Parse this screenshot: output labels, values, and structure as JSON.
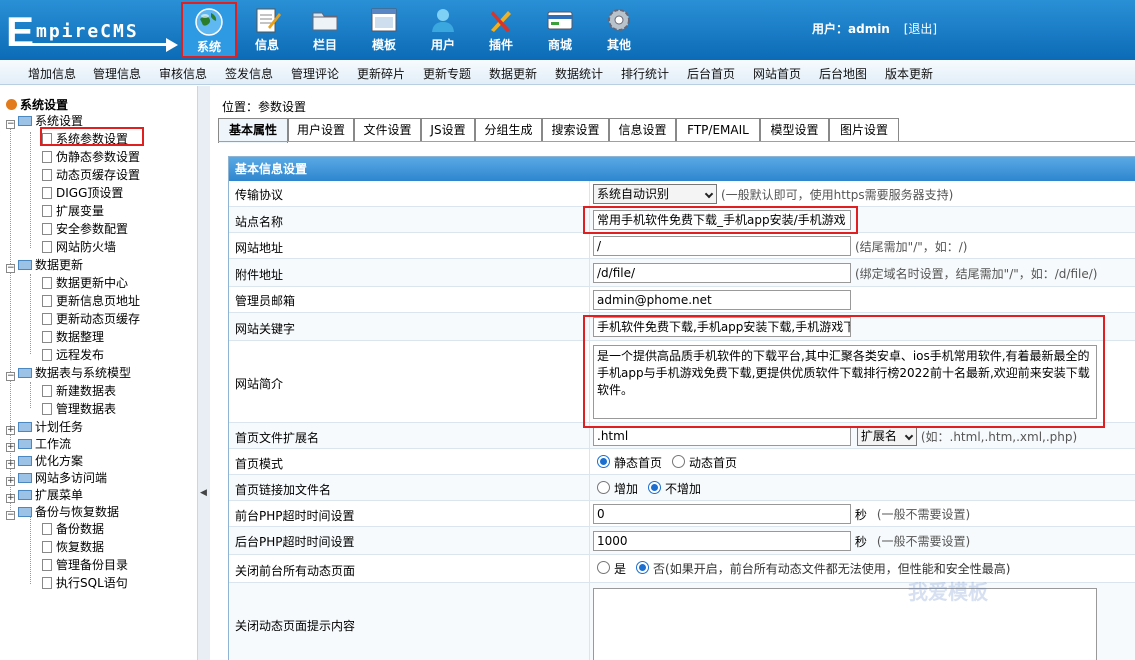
{
  "header": {
    "logo_initial": "E",
    "logo_rest": "mpireCMS",
    "nav": [
      {
        "label": "系统",
        "icon": "globe-icon",
        "active": true
      },
      {
        "label": "信息",
        "icon": "notepad-icon"
      },
      {
        "label": "栏目",
        "icon": "folder-icon"
      },
      {
        "label": "模板",
        "icon": "window-icon"
      },
      {
        "label": "用户",
        "icon": "user-icon"
      },
      {
        "label": "插件",
        "icon": "tools-icon"
      },
      {
        "label": "商城",
        "icon": "card-icon"
      },
      {
        "label": "其他",
        "icon": "gear-icon"
      }
    ],
    "user_label": "用户：admin",
    "logout": "[退出]"
  },
  "subnav": [
    "增加信息",
    "管理信息",
    "审核信息",
    "签发信息",
    "管理评论",
    "更新碎片",
    "更新专题",
    "数据更新",
    "数据统计",
    "排行统计",
    "后台首页",
    "网站首页",
    "后台地图",
    "版本更新"
  ],
  "sidebar": {
    "title": "系统设置",
    "groups": [
      {
        "label": "系统设置",
        "items": [
          "系统参数设置",
          "伪静态参数设置",
          "动态页缓存设置",
          "DIGG顶设置",
          "扩展变量",
          "安全参数配置",
          "网站防火墙"
        ]
      },
      {
        "label": "数据更新",
        "items": [
          "数据更新中心",
          "更新信息页地址",
          "更新动态页缓存",
          "数据整理",
          "远程发布"
        ]
      },
      {
        "label": "数据表与系统模型",
        "items": [
          "新建数据表",
          "管理数据表"
        ]
      },
      {
        "label": "计划任务",
        "items": []
      },
      {
        "label": "工作流",
        "items": []
      },
      {
        "label": "优化方案",
        "items": []
      },
      {
        "label": "网站多访问端",
        "items": []
      },
      {
        "label": "扩展菜单",
        "items": []
      },
      {
        "label": "备份与恢复数据",
        "items": [
          "备份数据",
          "恢复数据",
          "管理备份目录",
          "执行SQL语句"
        ]
      }
    ]
  },
  "main": {
    "crumb": "位置：参数设置",
    "tabs": [
      "基本属性",
      "用户设置",
      "文件设置",
      "JS设置",
      "分组生成",
      "搜索设置",
      "信息设置",
      "FTP/EMAIL",
      "模型设置",
      "图片设置"
    ],
    "form_title": "基本信息设置",
    "rows": {
      "protocol": {
        "label": "传输协议",
        "value": "系统自动识别",
        "hint": "(一般默认即可，使用https需要服务器支持)"
      },
      "site_name": {
        "label": "站点名称",
        "value": "常用手机软件免费下载_手机app安装/手机游戏"
      },
      "site_url": {
        "label": "网站地址",
        "value": "/",
        "hint": "(结尾需加\"/\"，如：/)"
      },
      "file_url": {
        "label": "附件地址",
        "value": "/d/file/",
        "hint": "(绑定域名时设置，结尾需加\"/\"，如：/d/file/)"
      },
      "admin_email": {
        "label": "管理员邮箱",
        "value": "admin@phome.net"
      },
      "keywords": {
        "label": "网站关键字",
        "value": "手机软件免费下载,手机app安装下载,手机游戏下"
      },
      "intro": {
        "label": "网站简介",
        "value": "是一个提供高品质手机软件的下载平台,其中汇聚各类安卓、ios手机常用软件,有着最新最全的手机app与手机游戏免费下载,更提供优质软件下载排行榜2022前十名最新,欢迎前来安装下载软件。"
      },
      "index_ext": {
        "label": "首页文件扩展名",
        "value": ".html",
        "select": "扩展名",
        "hint": "(如：.html,.htm,.xml,.php)"
      },
      "index_mode": {
        "label": "首页模式",
        "opt1": "静态首页",
        "opt2": "动态首页"
      },
      "index_link": {
        "label": "首页链接加文件名",
        "opt1": "增加",
        "opt2": "不增加"
      },
      "front_timeout": {
        "label": "前台PHP超时时间设置",
        "value": "0",
        "unit": "秒",
        "hint": "(一般不需要设置)"
      },
      "back_timeout": {
        "label": "后台PHP超时时间设置",
        "value": "1000",
        "unit": "秒",
        "hint": "(一般不需要设置)"
      },
      "close_dynamic": {
        "label": "关闭前台所有动态页面",
        "opt1": "是",
        "opt2": "否(如果开启，前台所有动态文件都无法使用，但性能和安全性最高)"
      },
      "close_tip": {
        "label": "关闭动态页面提示内容",
        "value": ""
      }
    }
  },
  "watermark": "我爱模板"
}
